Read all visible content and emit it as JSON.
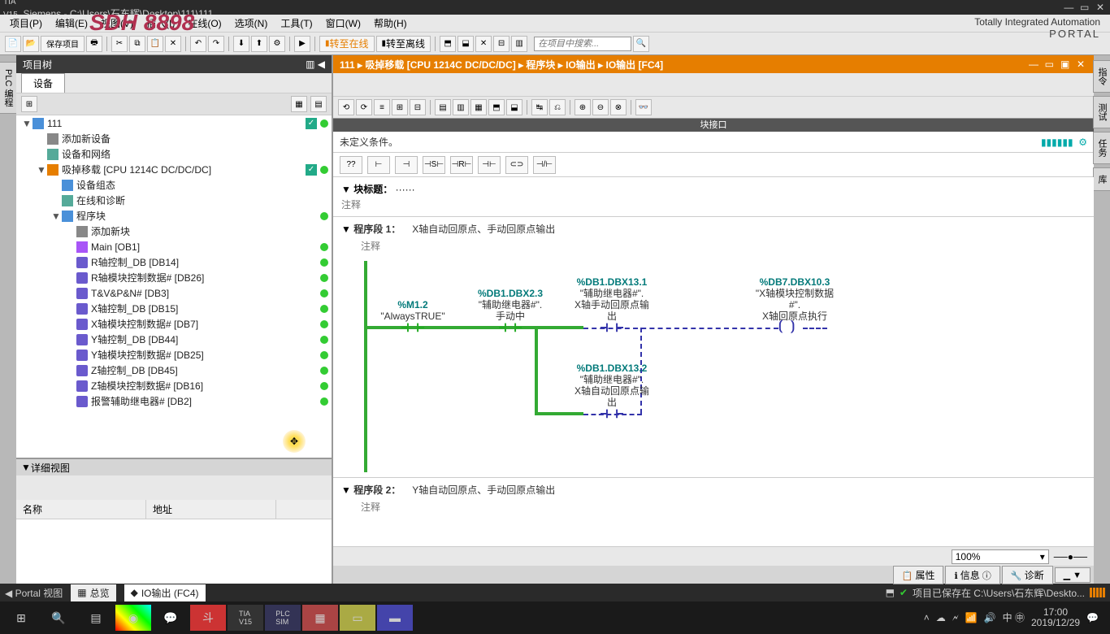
{
  "title": "Siemens  -  C:\\Users\\石东辉\\Desktop\\111\\111",
  "watermark": "SDH 8898",
  "menu": [
    "项目(P)",
    "编辑(E)",
    "视图(V)",
    "插入(I)",
    "在线(O)",
    "选项(N)",
    "工具(T)",
    "窗口(W)",
    "帮助(H)"
  ],
  "brand": {
    "line1": "Totally Integrated Automation",
    "line2": "PORTAL"
  },
  "toolbar": {
    "save": "保存项目",
    "goonline": "转至在线",
    "gooffline": "转至离线",
    "search_ph": "在项目中搜索..."
  },
  "leftpanel": {
    "title": "项目树",
    "tab": "设备",
    "detail_title": "详细视图",
    "detail_cols": [
      "名称",
      "地址"
    ]
  },
  "tree": [
    {
      "ind": 0,
      "tw": "▼",
      "ico": "ico-folder",
      "lbl": "111",
      "chk": true,
      "dot": true
    },
    {
      "ind": 1,
      "tw": "",
      "ico": "ico-add",
      "lbl": "添加新设备"
    },
    {
      "ind": 1,
      "tw": "",
      "ico": "ico-net",
      "lbl": "设备和网络"
    },
    {
      "ind": 1,
      "tw": "▼",
      "ico": "ico-dev",
      "lbl": "吸掉移载 [CPU 1214C DC/DC/DC]",
      "chk": true,
      "dot": true
    },
    {
      "ind": 2,
      "tw": "",
      "ico": "ico-folder",
      "lbl": "设备组态"
    },
    {
      "ind": 2,
      "tw": "",
      "ico": "ico-net",
      "lbl": "在线和诊断"
    },
    {
      "ind": 2,
      "tw": "▼",
      "ico": "ico-folder",
      "lbl": "程序块",
      "dot": true
    },
    {
      "ind": 3,
      "tw": "",
      "ico": "ico-add",
      "lbl": "添加新块"
    },
    {
      "ind": 3,
      "tw": "",
      "ico": "ico-block",
      "lbl": "Main [OB1]",
      "dot": true
    },
    {
      "ind": 3,
      "tw": "",
      "ico": "ico-db",
      "lbl": "R轴控制_DB [DB14]",
      "dot": true
    },
    {
      "ind": 3,
      "tw": "",
      "ico": "ico-db",
      "lbl": "R轴模块控制数据# [DB26]",
      "dot": true
    },
    {
      "ind": 3,
      "tw": "",
      "ico": "ico-db",
      "lbl": "T&V&P&N# [DB3]",
      "dot": true
    },
    {
      "ind": 3,
      "tw": "",
      "ico": "ico-db",
      "lbl": "X轴控制_DB [DB15]",
      "dot": true
    },
    {
      "ind": 3,
      "tw": "",
      "ico": "ico-db",
      "lbl": "X轴模块控制数据# [DB7]",
      "dot": true
    },
    {
      "ind": 3,
      "tw": "",
      "ico": "ico-db",
      "lbl": "Y轴控制_DB [DB44]",
      "dot": true
    },
    {
      "ind": 3,
      "tw": "",
      "ico": "ico-db",
      "lbl": "Y轴模块控制数据# [DB25]",
      "dot": true
    },
    {
      "ind": 3,
      "tw": "",
      "ico": "ico-db",
      "lbl": "Z轴控制_DB [DB45]",
      "dot": true
    },
    {
      "ind": 3,
      "tw": "",
      "ico": "ico-db",
      "lbl": "Z轴模块控制数据# [DB16]",
      "dot": true
    },
    {
      "ind": 3,
      "tw": "",
      "ico": "ico-db",
      "lbl": "报警辅助继电器# [DB2]",
      "dot": true
    }
  ],
  "editor": {
    "path": "111  ▸  吸掉移载 [CPU 1214C DC/DC/DC]  ▸  程序块  ▸  IO输出  ▸  IO输出 [FC4]",
    "blkint": "块接口",
    "cond": "未定义条件。",
    "title_lbl": "块标题：",
    "title_dots": "······",
    "comment": "注释",
    "net1": {
      "hdr": "程序段 1：",
      "desc": "X轴自动回原点、手动回原点输出",
      "comment": "注释"
    },
    "net2": {
      "hdr": "程序段 2：",
      "desc": "Y轴自动回原点、手动回原点输出",
      "comment": "注释"
    },
    "labels": {
      "c1a": "%M1.2",
      "c1b": "\"AlwaysTRUE\"",
      "c2a": "%DB1.DBX2.3",
      "c2b": "\"辅助继电器#\".",
      "c2c": "手动中",
      "c3a": "%DB1.DBX13.1",
      "c3b": "\"辅助继电器#\".",
      "c3c": "X轴手动回原点输",
      "c3d": "出",
      "o1a": "%DB7.DBX10.3",
      "o1b": "\"X轴模块控制数据",
      "o1c": "#\".",
      "o1d": "X轴回原点执行",
      "c4a": "%DB1.DBX13.2",
      "c4b": "\"辅助继电器#\".",
      "c4c": "X轴自动回原点输",
      "c4d": "出"
    },
    "zoom": "100%"
  },
  "proptabs": [
    "属性",
    "信息",
    "诊断"
  ],
  "footer": {
    "portal": "Portal 视图",
    "overview": "总览",
    "io": "IO输出 (FC4)",
    "saved": "项目已保存在 C:\\Users\\石东辉\\Deskto..."
  },
  "rside": [
    "指令",
    "测试",
    "任务",
    "库"
  ],
  "vside": "PLC 编程",
  "clock": {
    "time": "17:00",
    "date": "2019/12/29",
    "ime": "中 ㊥"
  }
}
